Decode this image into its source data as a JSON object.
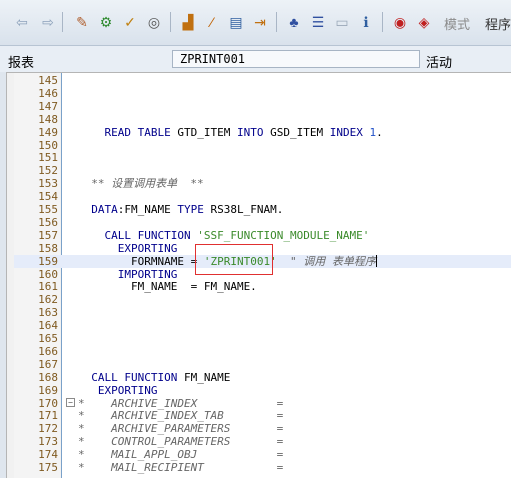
{
  "toolbar": {
    "icons": [
      "back-arrow-icon",
      "forward-arrow-icon",
      "edit-pen-icon",
      "toggle-active-icon",
      "check-icon",
      "activate-target-icon",
      "object-list-icon",
      "pencil-magic-icon",
      "where-used-icon",
      "display-object-icon",
      "hierarchy-icon",
      "stack-icon",
      "screen-icon",
      "info-icon",
      "breakpoint-icon",
      "session-breakpoint-icon"
    ],
    "mode_label": "模式",
    "program_label": "程序"
  },
  "header": {
    "object_type_label": "报表",
    "program_name": "ZPRINT001",
    "status_label": "活动"
  },
  "editor": {
    "current_line": "159",
    "lines": [
      {
        "no": "145",
        "code": ""
      },
      {
        "no": "146",
        "code": ""
      },
      {
        "no": "147",
        "code": ""
      },
      {
        "no": "148",
        "code": ""
      },
      {
        "no": "149",
        "code": "    READ TABLE GTD_ITEM INTO GSD_ITEM INDEX 1."
      },
      {
        "no": "150",
        "code": ""
      },
      {
        "no": "151",
        "code": ""
      },
      {
        "no": "152",
        "code": ""
      },
      {
        "no": "153",
        "code": "  ** 设置调用表单  **"
      },
      {
        "no": "154",
        "code": ""
      },
      {
        "no": "155",
        "code": "  DATA:FM_NAME TYPE RS38L_FNAM."
      },
      {
        "no": "156",
        "code": ""
      },
      {
        "no": "157",
        "code": "    CALL FUNCTION 'SSF_FUNCTION_MODULE_NAME'"
      },
      {
        "no": "158",
        "code": "      EXPORTING"
      },
      {
        "no": "159",
        "code": "        FORMNAME = 'ZPRINT001'  \" 调用 表单程序"
      },
      {
        "no": "160",
        "code": "      IMPORTING"
      },
      {
        "no": "161",
        "code": "        FM_NAME  = FM_NAME."
      },
      {
        "no": "162",
        "code": ""
      },
      {
        "no": "163",
        "code": ""
      },
      {
        "no": "164",
        "code": ""
      },
      {
        "no": "165",
        "code": ""
      },
      {
        "no": "166",
        "code": ""
      },
      {
        "no": "167",
        "code": ""
      },
      {
        "no": "168",
        "code": "  CALL FUNCTION FM_NAME"
      },
      {
        "no": "169",
        "code": "   EXPORTING"
      },
      {
        "no": "170",
        "code": "*    ARCHIVE_INDEX            ="
      },
      {
        "no": "171",
        "code": "*    ARCHIVE_INDEX_TAB        ="
      },
      {
        "no": "172",
        "code": "*    ARCHIVE_PARAMETERS       ="
      },
      {
        "no": "173",
        "code": "*    CONTROL_PARAMETERS       ="
      },
      {
        "no": "174",
        "code": "*    MAIL_APPL_OBJ            ="
      },
      {
        "no": "175",
        "code": "*    MAIL_RECIPIENT           ="
      }
    ]
  }
}
